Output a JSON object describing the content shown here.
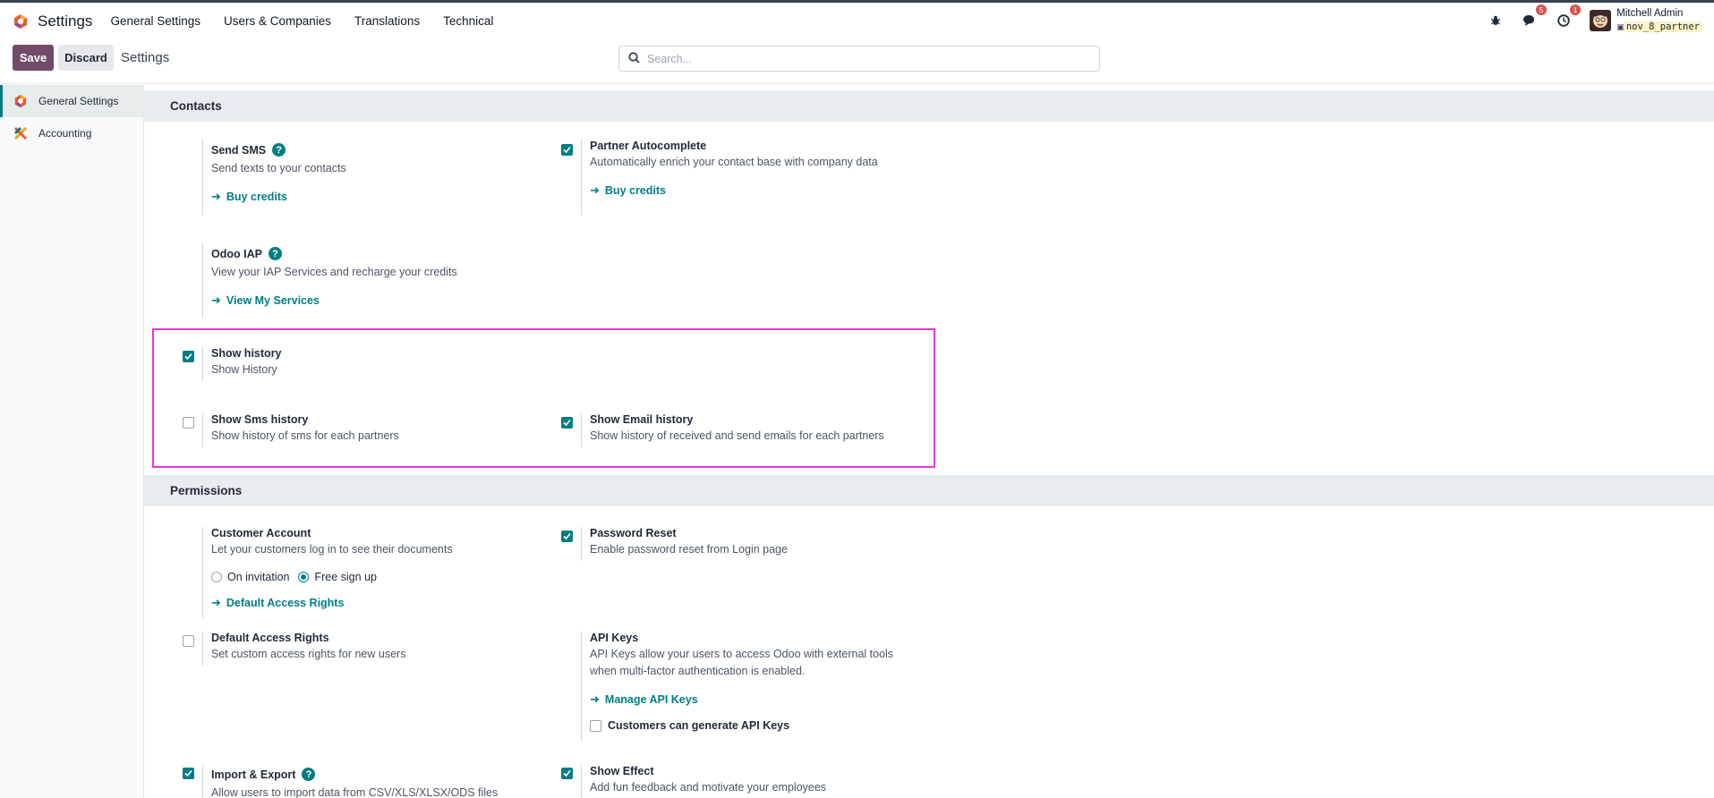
{
  "navbar": {
    "app_name": "Settings",
    "menu": [
      "General Settings",
      "Users & Companies",
      "Translations",
      "Technical"
    ],
    "chat_badge": "5",
    "activity_badge": "1",
    "user_name": "Mitchell Admin",
    "db_name": "nov_8_partner",
    "colors": {
      "brand": "#714b67",
      "accent": "#017e84",
      "badge": "#d9534f"
    }
  },
  "control": {
    "save_label": "Save",
    "discard_label": "Discard",
    "title": "Settings",
    "search_placeholder": "Search..."
  },
  "sidebar": {
    "items": [
      {
        "label": "General Settings",
        "icon": "odoo-logo-icon",
        "active": true
      },
      {
        "label": "Accounting",
        "icon": "accounting-app-icon",
        "active": false
      }
    ]
  },
  "sections": {
    "contacts": {
      "title": "Contacts",
      "send_sms": {
        "title": "Send SMS",
        "desc": "Send texts to your contacts",
        "link": "Buy credits"
      },
      "partner_autocomplete": {
        "title": "Partner Autocomplete",
        "desc": "Automatically enrich your contact base with company data",
        "link": "Buy credits",
        "checked": true
      },
      "odoo_iap": {
        "title": "Odoo IAP",
        "desc": "View your IAP Services and recharge your credits",
        "link": "View My Services"
      },
      "show_history": {
        "title": "Show history",
        "desc": "Show History",
        "checked": true
      },
      "show_sms_history": {
        "title": "Show Sms history",
        "desc": "Show history of sms for each partners",
        "checked": false
      },
      "show_email_history": {
        "title": "Show Email history",
        "desc": "Show history of received and send emails for each partners",
        "checked": true
      }
    },
    "permissions": {
      "title": "Permissions",
      "customer_account": {
        "title": "Customer Account",
        "desc": "Let your customers log in to see their documents",
        "option_invitation": "On invitation",
        "option_free": "Free sign up",
        "link": "Default Access Rights"
      },
      "password_reset": {
        "title": "Password Reset",
        "desc": "Enable password reset from Login page",
        "checked": true
      },
      "default_access_rights": {
        "title": "Default Access Rights",
        "desc": "Set custom access rights for new users",
        "checked": false
      },
      "api_keys": {
        "title": "API Keys",
        "desc_line1": "API Keys allow your users to access Odoo with external tools",
        "desc_line2": "when multi-factor authentication is enabled.",
        "link": "Manage API Keys",
        "customers_generate": "Customers can generate API Keys"
      },
      "import_export": {
        "title": "Import & Export",
        "desc": "Allow users to import data from CSV/XLS/XLSX/ODS files",
        "checked": true
      },
      "show_effect": {
        "title": "Show Effect",
        "desc": "Add fun feedback and motivate your employees",
        "checked": true
      }
    }
  }
}
